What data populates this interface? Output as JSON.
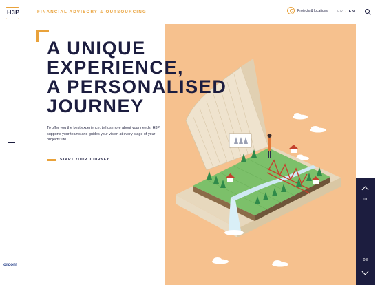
{
  "brand": {
    "logo_text": "H3P",
    "tagline": "FINANCIAL ADVISORY & OUTSOURCING",
    "partner_logo": "orcom"
  },
  "header": {
    "projects_label": "Projects & locations",
    "projects_icon": "map-pin-icon",
    "lang": {
      "fr": "FR",
      "separator": "/",
      "en": "EN",
      "active": "EN"
    },
    "search_icon": "search-icon"
  },
  "hero": {
    "title_lines": [
      "A UNIQUE",
      "EXPERIENCE,",
      "A PERSONALISED",
      "JOURNEY"
    ],
    "text": "To offer you the best experience, tell us more about your needs. H3P supports your teams and guides your vision at every stage of your projects' life.",
    "cta_label": "START YOUR JOURNEY"
  },
  "slider": {
    "current": "01",
    "total": "03"
  },
  "colors": {
    "accent": "#e9a23b",
    "navy": "#1c1d3f",
    "illustration_bg": "#f6c18e"
  }
}
